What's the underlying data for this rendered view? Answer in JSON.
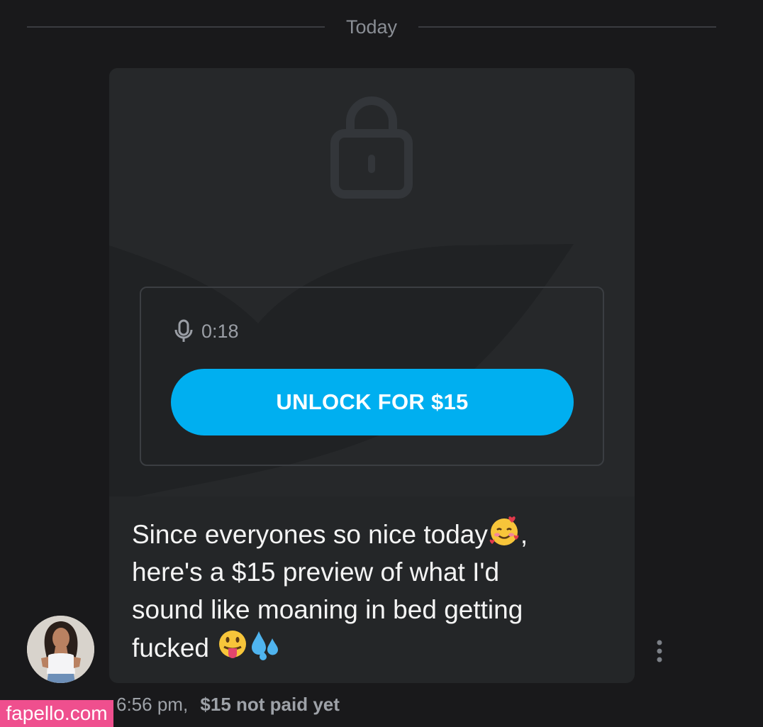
{
  "chat": {
    "date_divider": "Today",
    "message": {
      "media": {
        "duration": "0:18",
        "unlock_label": "UNLOCK FOR $15"
      },
      "text_lines": [
        "Since everyones so nice today",
        "here's a $15 preview of what I'd",
        "sound like moaning in bed getting",
        "fucked "
      ],
      "line1_suffix": ",",
      "time": "6:56 pm,",
      "price_status": "$15 not paid yet"
    }
  },
  "watermark": "fapello.com",
  "icons": [
    "lock-icon",
    "microphone-icon",
    "smiling-hearts-emoji",
    "tongue-emoji",
    "sweat-droplets-emoji",
    "more-vertical-icon",
    "avatar"
  ],
  "colors": {
    "background": "#19191b",
    "bubble": "#242628",
    "accent": "#00aff0",
    "watermark": "#ef4f8e",
    "muted_text": "#9ea2a8"
  }
}
